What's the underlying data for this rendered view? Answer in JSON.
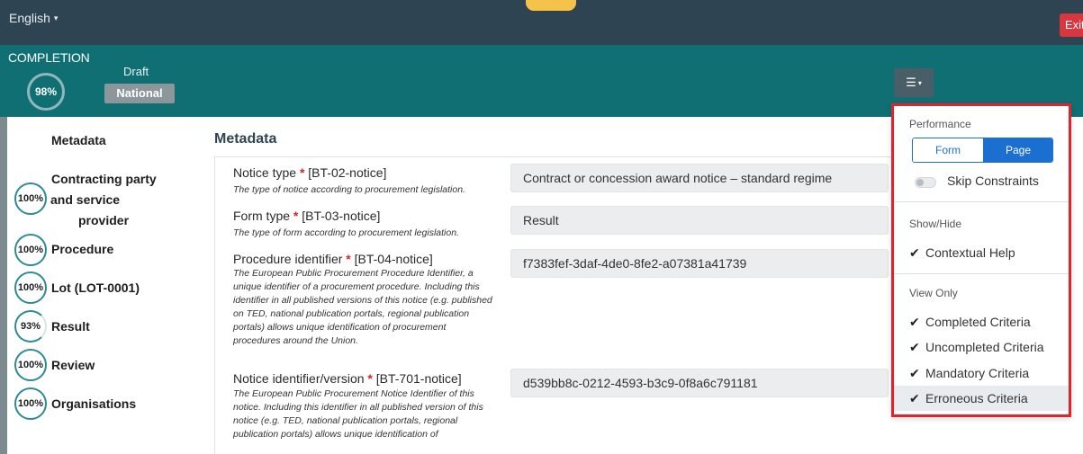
{
  "topbar": {
    "language": "English",
    "caret_glyph": "▾",
    "top_badge": "",
    "exit_label": "Exit"
  },
  "completion": {
    "label": "COMPLETION",
    "percent": "98%",
    "status": "Draft",
    "scope": "National",
    "settings_icon": "sliders-icon",
    "settings_glyph": "☰",
    "settings_caret": "▾"
  },
  "nav": {
    "items": [
      {
        "label": "Metadata",
        "percent": ""
      },
      {
        "label_line1": "Contracting party",
        "label_line2": "and service",
        "label_line3": "provider",
        "percent": "100%"
      },
      {
        "label": "Procedure",
        "percent": "100%"
      },
      {
        "label": "Lot (LOT-0001)",
        "percent": "100%"
      },
      {
        "label": "Result",
        "percent": "93%"
      },
      {
        "label": "Review",
        "percent": "100%"
      },
      {
        "label": "Organisations",
        "percent": "100%"
      }
    ]
  },
  "main": {
    "title": "Metadata",
    "required_mark": "*",
    "fields": [
      {
        "label": "Notice type",
        "code": "[BT-02-notice]",
        "help": "The type of notice according to procurement legislation.",
        "value": "Contract or concession award notice – standard regime"
      },
      {
        "label": "Form type",
        "code": "[BT-03-notice]",
        "help": "The type of form according to procurement legislation.",
        "value": "Result"
      },
      {
        "label": "Procedure identifier",
        "code": "[BT-04-notice]",
        "help": "The European Public Procurement Procedure Identifier, a unique identifier of a procurement procedure. Including this identifier in all published versions of this notice (e.g. published on TED, national publication portals, regional publication portals) allows unique identification of procurement procedures around the Union.",
        "value": "f7383fef-3daf-4de0-8fe2-a07381a41739"
      },
      {
        "label": "Notice identifier/version",
        "code": "[BT-701-notice]",
        "help": "The European Public Procurement Notice Identifier of this notice. Including this identifier in all published version of this notice (e.g. TED, national publication portals, regional publication portals) allows unique identification of",
        "value": "d539bb8c-0212-4593-b3c9-0f8a6c791181"
      }
    ]
  },
  "dropdown": {
    "performance_header": "Performance",
    "form_option": "Form",
    "page_option": "Page",
    "skip_constraints": "Skip Constraints",
    "show_hide_header": "Show/Hide",
    "contextual_help": "Contextual Help",
    "view_only_header": "View Only",
    "check_glyph": "✔",
    "view_items": [
      "Completed Criteria",
      "Uncompleted Criteria",
      "Mandatory Criteria",
      "Erroneous Criteria"
    ]
  },
  "colors": {
    "topbar": "#2f4452",
    "completion_band": "#0f6f73",
    "accent_blue": "#1a6fd1",
    "highlight_red": "#e0232d",
    "exit_red": "#d9363e"
  }
}
